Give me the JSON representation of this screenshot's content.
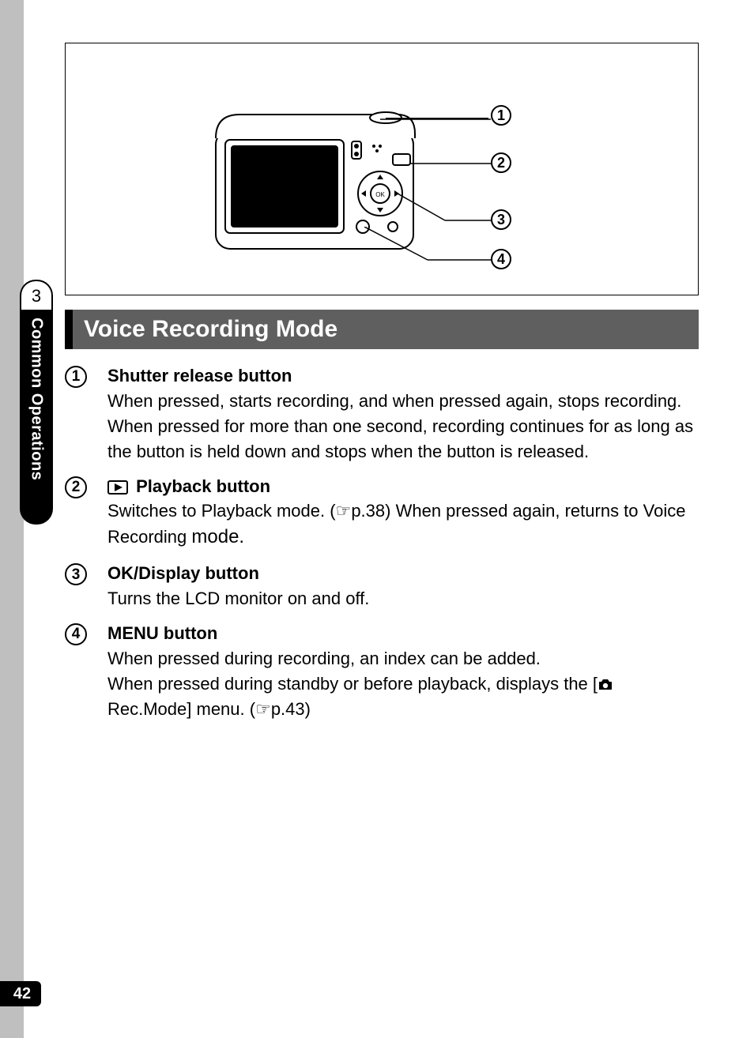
{
  "side_tab": {
    "chapter_number": "3",
    "label": "Common Operations"
  },
  "page_number": "42",
  "diagram": {
    "callouts": [
      "1",
      "2",
      "3",
      "4"
    ]
  },
  "section_title": "Voice Recording Mode",
  "items": [
    {
      "num": "1",
      "title": "Shutter release button",
      "body_a": "When pressed, starts recording, and when pressed again, stops recording.",
      "body_b": "When pressed for more than one second, recording continues for as long as the button is held down and stops when the button is released."
    },
    {
      "num": "2",
      "title_prefix_icon": "playback",
      "title": " Playback button",
      "body_a_pre": "Switches to Playback mode. (",
      "body_a_ref": "p.38",
      "body_a_post": ") When pressed again, returns to Voice Recording ",
      "body_a_tail": "mode."
    },
    {
      "num": "3",
      "title": "OK/Display button",
      "body_a": "Turns the LCD monitor on and off."
    },
    {
      "num": "4",
      "title": "MENU button",
      "body_a": "When pressed during recording, an index can be added.",
      "body_b_pre": "When pressed during standby or before playback, displays the [",
      "body_b_mid": " Rec.Mode] menu. (",
      "body_b_ref": "p.43",
      "body_b_post": ")"
    }
  ]
}
